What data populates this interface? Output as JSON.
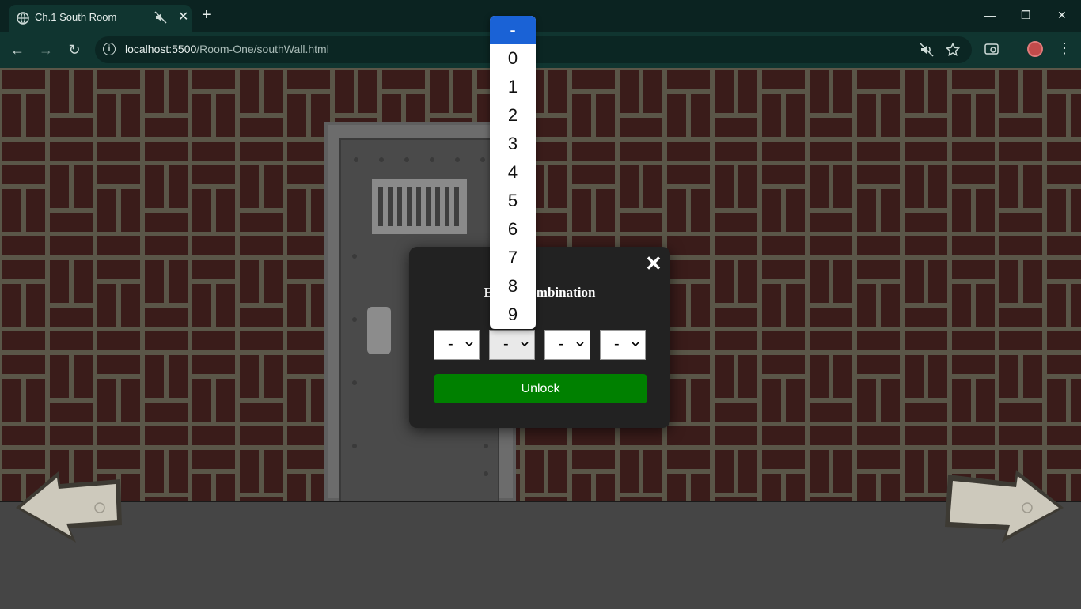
{
  "browser": {
    "tab_title": "Ch.1 South Room",
    "url_host": "localhost:5500",
    "url_path": "/Room-One/southWall.html"
  },
  "colors": {
    "wall_brick": "#3a1c1a",
    "mortar": "#5a5648",
    "floor": "#454545",
    "modal_bg": "#222222",
    "unlock_button": "#008000",
    "selected_option": "#1a62d6"
  },
  "modal": {
    "title": "Enter Combination",
    "close_label": "✕",
    "selects": [
      "-",
      "-",
      "-",
      "-"
    ],
    "unlock_label": "Unlock"
  },
  "dropdown": {
    "options": [
      "-",
      "0",
      "1",
      "2",
      "3",
      "4",
      "5",
      "6",
      "7",
      "8",
      "9"
    ],
    "selected": "-"
  },
  "scene": {
    "door": "metal-cell-door",
    "nav_left": "stone-arrow-left",
    "nav_right": "stone-arrow-right"
  }
}
